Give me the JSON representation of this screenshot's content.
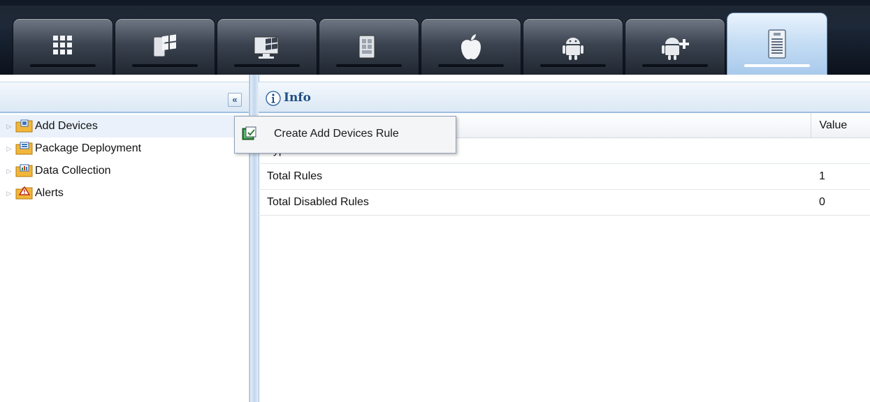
{
  "tabs": [
    {
      "icon": "all-devices-grid-icon",
      "active": false
    },
    {
      "icon": "windows-mobile-icon",
      "active": false
    },
    {
      "icon": "windows-desktop-icon",
      "active": false
    },
    {
      "icon": "windows-phone-icon",
      "active": false
    },
    {
      "icon": "apple-icon",
      "active": false
    },
    {
      "icon": "android-icon",
      "active": false
    },
    {
      "icon": "android-plus-icon",
      "active": false
    },
    {
      "icon": "document-list-icon",
      "active": true
    }
  ],
  "left_panel": {
    "collapse_glyph": "«",
    "tree": [
      {
        "label": "Add Devices",
        "icon": "folder-add-devices-icon",
        "selected": true
      },
      {
        "label": "Package Deployment",
        "icon": "folder-package-icon",
        "selected": false
      },
      {
        "label": "Data Collection",
        "icon": "folder-data-icon",
        "selected": false
      },
      {
        "label": "Alerts",
        "icon": "folder-alert-icon",
        "selected": false
      }
    ]
  },
  "info_panel": {
    "title": "Info",
    "columns": [
      "",
      "Value"
    ],
    "rows": [
      {
        "name": "Type",
        "value": ""
      },
      {
        "name": "Total Rules",
        "value": "1"
      },
      {
        "name": "Total Disabled Rules",
        "value": "0"
      }
    ]
  },
  "context_menu": {
    "items": [
      {
        "label": "Create Add Devices Rule",
        "icon": "create-rule-icon"
      }
    ]
  },
  "colors": {
    "header_bg": "#1b2636",
    "active_tab": "#c3dcf3",
    "panel_header": "#dbe8f5",
    "info_title": "#1f4f85"
  }
}
